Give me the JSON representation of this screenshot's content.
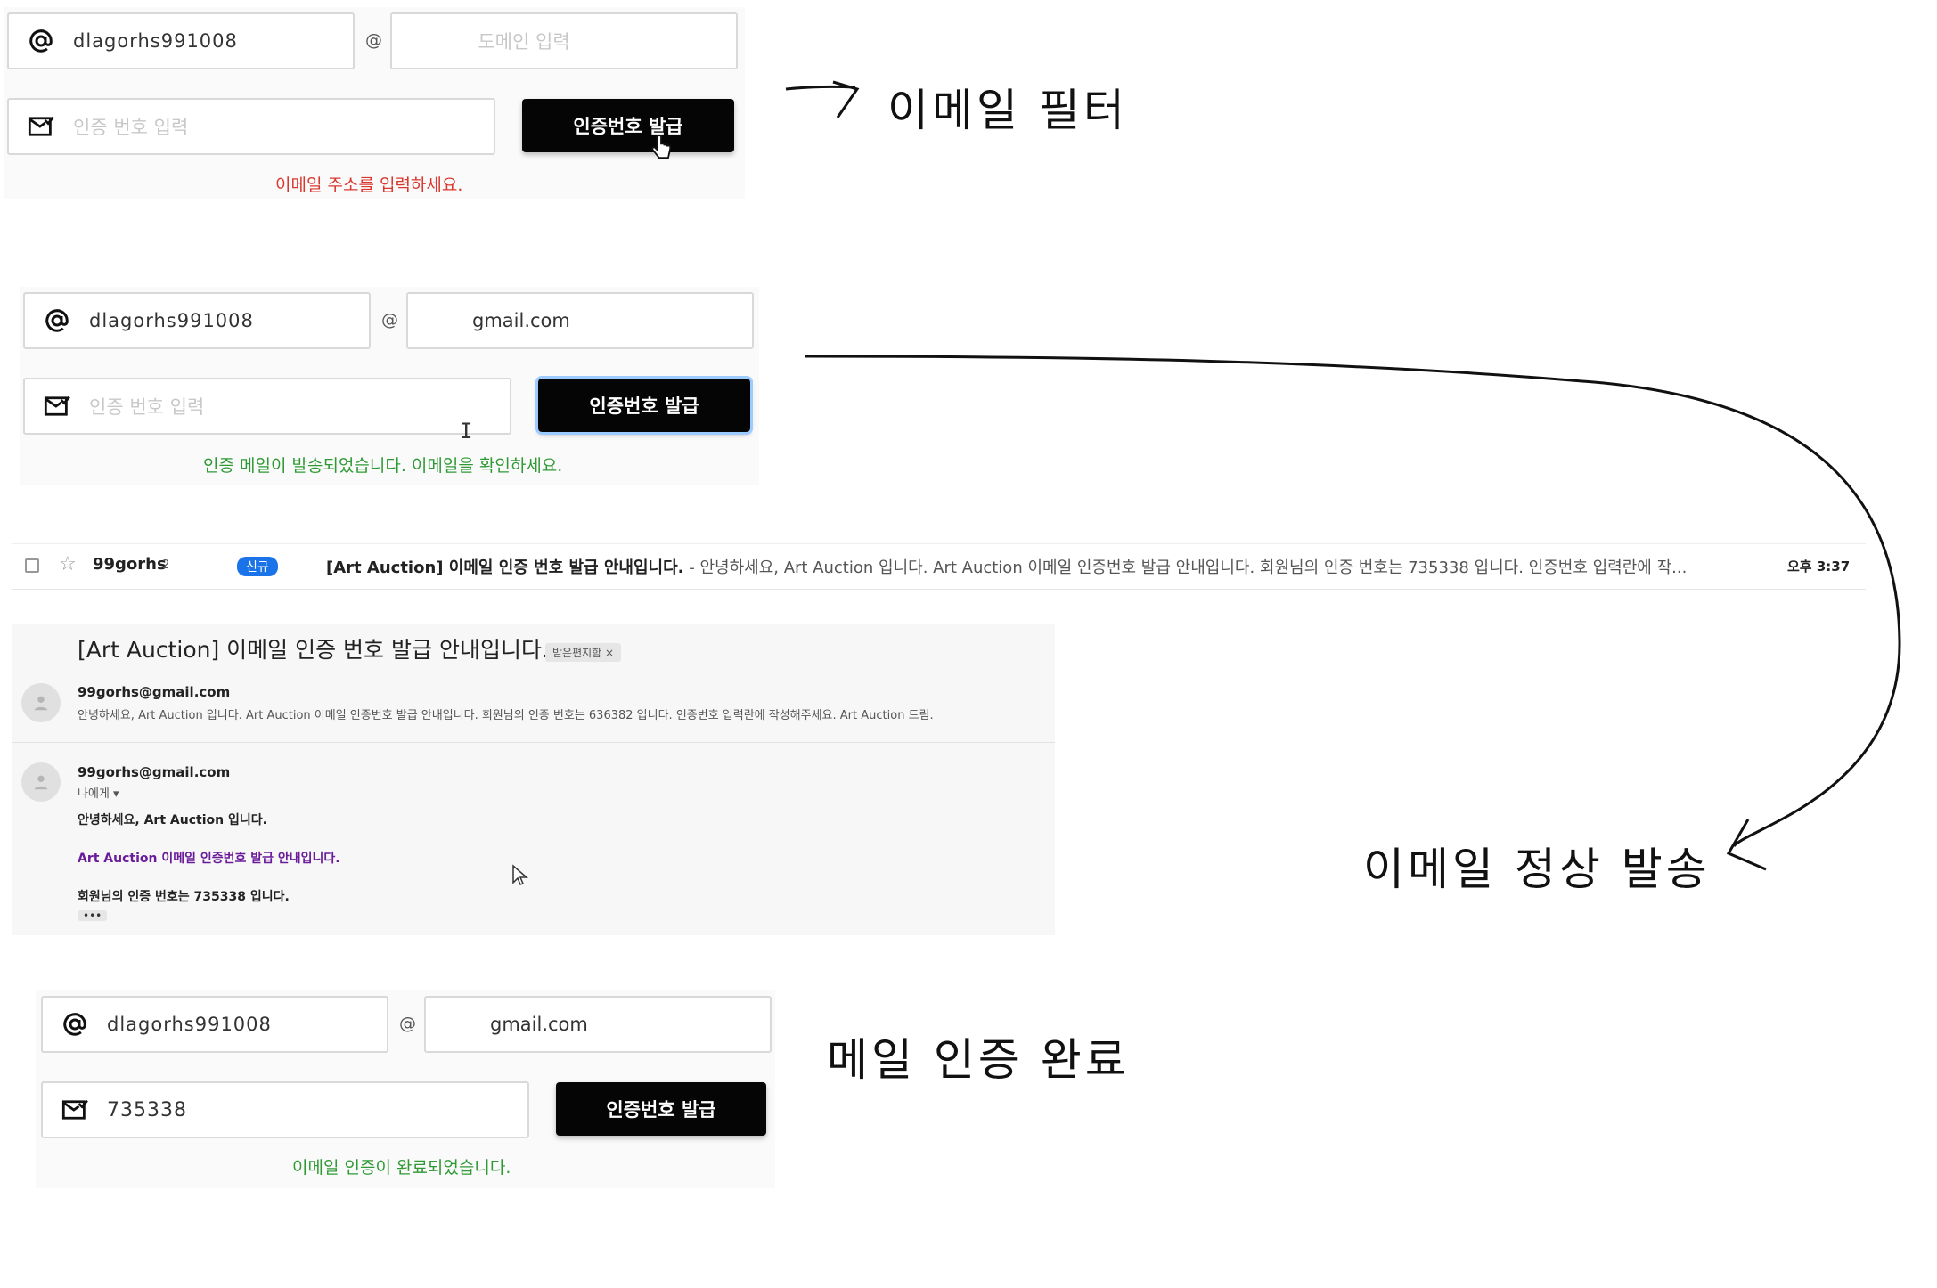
{
  "section1": {
    "email_local": "dlagorhs991008",
    "at": "@",
    "domain_placeholder": "도메인 입력",
    "code_placeholder": "인증 번호 입력",
    "button": "인증번호 발급",
    "message": "이메일 주소를 입력하세요."
  },
  "section2": {
    "email_local": "dlagorhs991008",
    "at": "@",
    "domain": "gmail.com",
    "code_placeholder": "인증 번호 입력",
    "button": "인증번호 발급",
    "message": "인증 메일이 발송되었습니다. 이메일을 확인하세요."
  },
  "inbox_row": {
    "sender": "99gorhs",
    "count": "2",
    "badge": "신규",
    "subject": "[Art Auction] 이메일 인증 번호 발급 안내입니다.",
    "snippet": " - 안녕하세요, Art Auction 입니다. Art Auction 이메일 인증번호 발급 안내입니다. 회원님의 인증 번호는 735338 입니다. 인증번호 입력란에 작...",
    "time": "오후 3:37"
  },
  "mail_view": {
    "subject": "[Art Auction] 이메일 인증 번호 발급 안내입니다.",
    "label": "받은편지함 ×",
    "msg1_sender": "99gorhs@gmail.com",
    "msg1_snippet": "안녕하세요, Art Auction 입니다. Art Auction 이메일 인증번호 발급 안내입니다. 회원님의 인증 번호는 636382 입니다. 인증번호 입력란에 작성해주세요. Art Auction 드림.",
    "msg2_sender": "99gorhs@gmail.com",
    "msg2_to": "나에게 ▾",
    "line1": "안녕하세요, Art Auction 입니다.",
    "line2": "Art Auction 이메일 인증번호 발급 안내입니다.",
    "line3": "회원님의 인증 번호는 735338 입니다.",
    "more": "•••"
  },
  "section3": {
    "email_local": "dlagorhs991008",
    "at": "@",
    "domain": "gmail.com",
    "code": "735338",
    "button": "인증번호 발급",
    "message": "이메일 인증이 완료되었습니다."
  },
  "annotations": {
    "filter": "이메일 필터",
    "sent": "이메일 정상 발송",
    "done": "메일 인증 완료"
  },
  "colors": {
    "error": "#d9382f",
    "success": "#2f9a35",
    "button": "#050505",
    "badge": "#1a73e8"
  }
}
